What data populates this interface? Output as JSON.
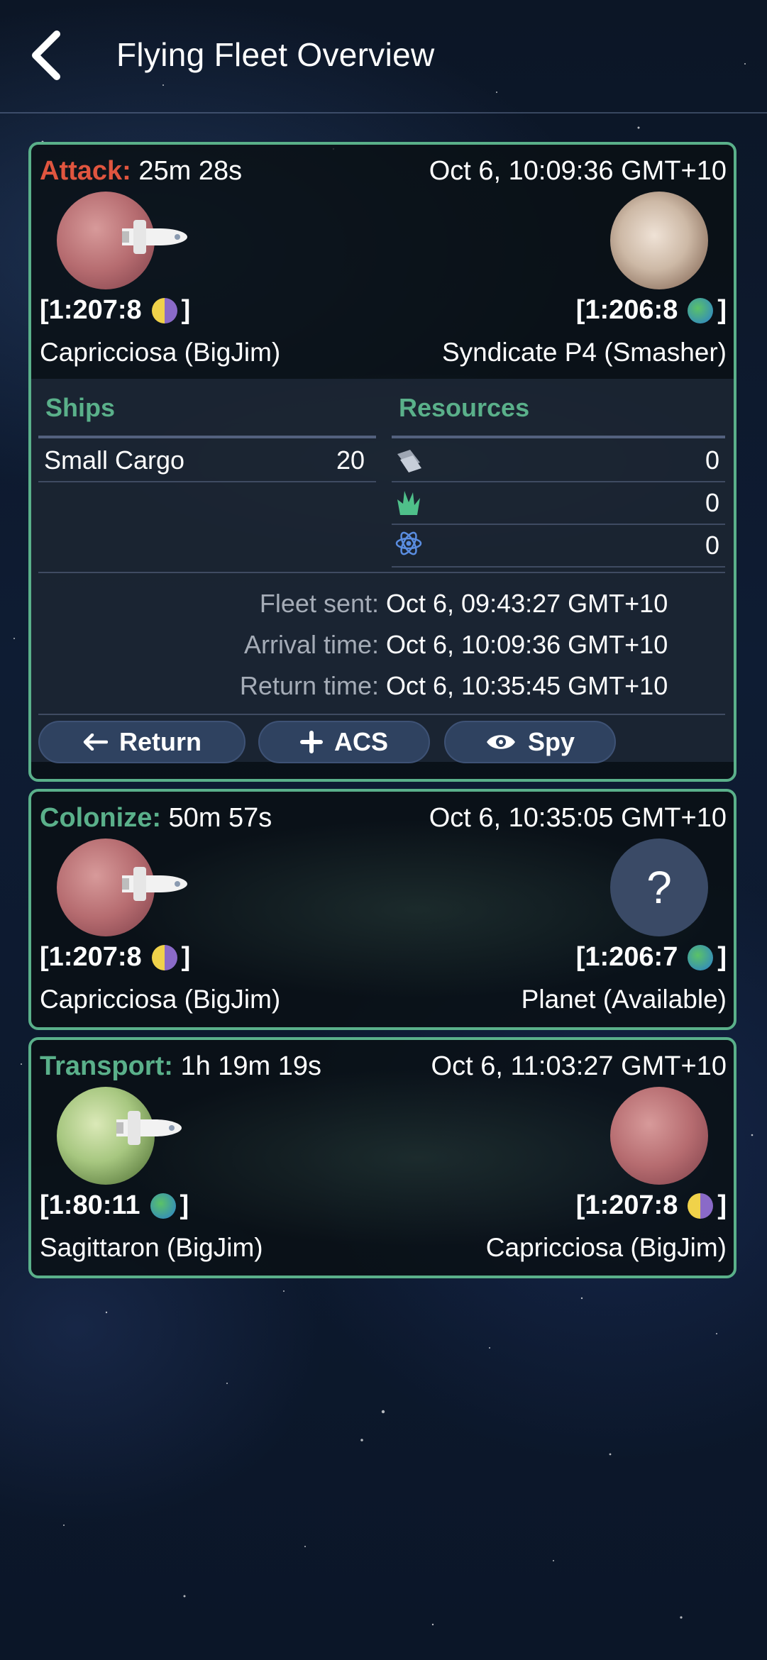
{
  "header": {
    "title": "Flying Fleet Overview"
  },
  "colors": {
    "attack": "#e0553f",
    "colonize": "#5ab08a",
    "transport": "#5ab08a",
    "card_border": "#5ab08a"
  },
  "fleets": [
    {
      "mission": "Attack:",
      "countdown": "25m 28s",
      "arrival": "Oct 6, 10:09:36 GMT+10",
      "origin": {
        "coord": "[1:207:8",
        "type_icon": "moon-icon",
        "name": "Capricciosa (BigJim)",
        "planet": "red-moon"
      },
      "target": {
        "coord": "[1:206:8",
        "type_icon": "planet-icon",
        "name": "Syndicate P4 (Smasher)",
        "planet": "beige-planet"
      },
      "ships_header": "Ships",
      "resources_header": "Resources",
      "ships": [
        {
          "name": "Small Cargo",
          "count": "20"
        }
      ],
      "resources": [
        {
          "icon": "metal-icon",
          "value": "0"
        },
        {
          "icon": "crystal-icon",
          "value": "0"
        },
        {
          "icon": "deuterium-icon",
          "value": "0"
        }
      ],
      "times": [
        {
          "label": "Fleet sent:",
          "value": "Oct 6, 09:43:27 GMT+10"
        },
        {
          "label": "Arrival time:",
          "value": "Oct 6, 10:09:36 GMT+10"
        },
        {
          "label": "Return time:",
          "value": "Oct 6, 10:35:45 GMT+10"
        }
      ],
      "buttons": {
        "return": "Return",
        "acs": "ACS",
        "spy": "Spy"
      }
    },
    {
      "mission": "Colonize:",
      "countdown": "50m 57s",
      "arrival": "Oct 6, 10:35:05 GMT+10",
      "origin": {
        "coord": "[1:207:8",
        "type_icon": "moon-icon",
        "name": "Capricciosa (BigJim)",
        "planet": "red-moon"
      },
      "target": {
        "coord": "[1:206:7",
        "type_icon": "planet-icon",
        "name": "Planet (Available)",
        "unknown_glyph": "?"
      }
    },
    {
      "mission": "Transport:",
      "countdown": "1h 19m 19s",
      "arrival": "Oct 6, 11:03:27 GMT+10",
      "origin": {
        "coord": "[1:80:11",
        "type_icon": "planet-icon",
        "name": "Sagittaron (BigJim)",
        "planet": "green-planet"
      },
      "target": {
        "coord": "[1:207:8",
        "type_icon": "moon-icon",
        "name": "Capricciosa (BigJim)",
        "planet": "red-moon"
      }
    }
  ]
}
